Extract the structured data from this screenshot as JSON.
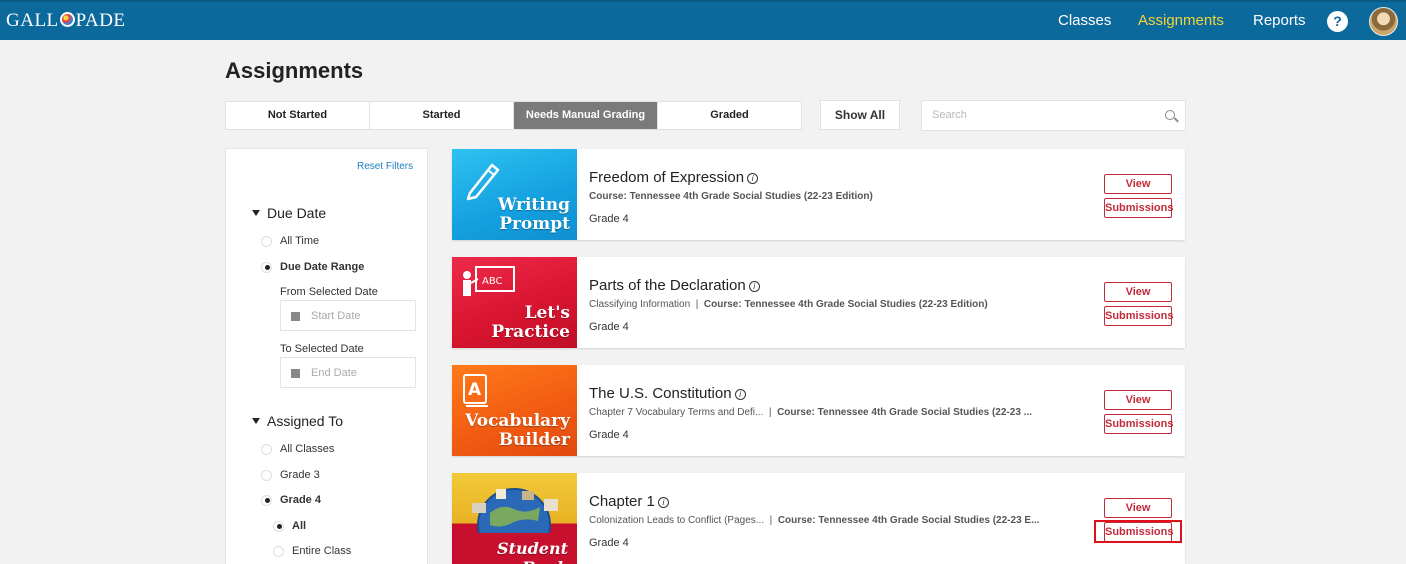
{
  "topbar": {
    "logo_text_a": "GALL",
    "logo_text_b": "PADE",
    "nav": {
      "classes": "Classes",
      "assignments": "Assignments",
      "reports": "Reports"
    },
    "help_label": "?",
    "accent_color": "#0b6a9b",
    "active_color": "#f3d33a"
  },
  "page": {
    "title": "Assignments"
  },
  "tabs": [
    {
      "label": "Not Started"
    },
    {
      "label": "Started"
    },
    {
      "label": "Needs Manual Grading",
      "active": true
    },
    {
      "label": "Graded"
    }
  ],
  "show_all_label": "Show All",
  "search": {
    "placeholder": "Search"
  },
  "filters": {
    "reset_label": "Reset Filters",
    "due_date": {
      "heading": "Due Date",
      "options": [
        "All Time",
        "Due Date Range"
      ],
      "selected": "Due Date Range",
      "from_label": "From Selected Date",
      "from_placeholder": "Start Date",
      "to_label": "To Selected Date",
      "to_placeholder": "End Date"
    },
    "assigned_to": {
      "heading": "Assigned To",
      "options": [
        "All Classes",
        "Grade 3",
        "Grade 4"
      ],
      "selected": "Grade 4",
      "sub_options": [
        "All",
        "Entire Class"
      ],
      "sub_selected": "All"
    }
  },
  "assignments": [
    {
      "title": "Freedom of Expression",
      "thumb_line1": "Writing",
      "thumb_line2": "Prompt",
      "thumb_icon": "pencil-icon",
      "prefix": "",
      "course_label": "Course:",
      "course": "Tennessee 4th Grade Social Studies (22-23 Edition)",
      "grade": "Grade 4",
      "view_label": "View",
      "submissions_label": "Submissions"
    },
    {
      "title": "Parts of the Declaration",
      "thumb_line1": "Let's",
      "thumb_line2": "Practice",
      "thumb_icon": "teacher-board-icon",
      "prefix": "Classifying Information",
      "course_label": "Course:",
      "course": "Tennessee 4th Grade Social Studies (22-23 Edition)",
      "grade": "Grade 4",
      "view_label": "View",
      "submissions_label": "Submissions"
    },
    {
      "title": "The U.S. Constitution",
      "thumb_line1": "Vocabulary",
      "thumb_line2": "Builder",
      "thumb_icon": "vocabulary-book-icon",
      "prefix": "Chapter 7 Vocabulary Terms and Defi...",
      "course_label": "Course:",
      "course": "Tennessee 4th Grade Social Studies (22-23 ...",
      "grade": "Grade 4",
      "view_label": "View",
      "submissions_label": "Submissions"
    },
    {
      "title": "Chapter 1",
      "thumb_line1": "Student Book",
      "thumb_line2": "",
      "thumb_icon": "globe-collage-icon",
      "prefix": "Colonization Leads to Conflict (Pages...",
      "course_label": "Course:",
      "course": "Tennessee 4th Grade Social Studies (22-23 E...",
      "grade": "Grade 4",
      "view_label": "View",
      "submissions_label": "Submissions"
    }
  ]
}
